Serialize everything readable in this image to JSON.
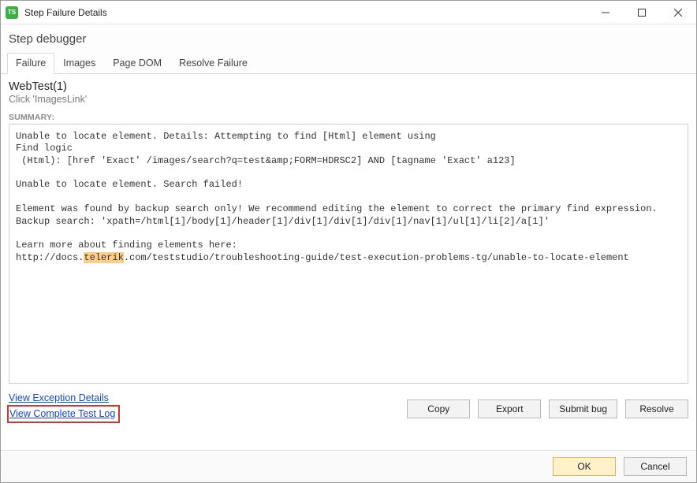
{
  "window": {
    "title": "Step Failure Details",
    "appIconText": "TS"
  },
  "heading": "Step debugger",
  "tabs": [
    {
      "label": "Failure",
      "active": true
    },
    {
      "label": "Images",
      "active": false
    },
    {
      "label": "Page DOM",
      "active": false
    },
    {
      "label": "Resolve Failure",
      "active": false
    }
  ],
  "test": {
    "name": "WebTest(1)",
    "step": "Click 'ImagesLink'"
  },
  "summaryLabel": "SUMMARY:",
  "summary": {
    "line1": "Unable to locate element. Details: Attempting to find [Html] element using",
    "line2": "Find logic",
    "line3": " (Html): [href 'Exact' /images/search?q=test&amp;FORM=HDRSC2] AND [tagname 'Exact' a123]",
    "line4": "Unable to locate element. Search failed!",
    "line5": "Element was found by backup search only! We recommend editing the element to correct the primary find expression.",
    "line6": "Backup search: 'xpath=/html[1]/body[1]/header[1]/div[1]/div[1]/div[1]/nav[1]/ul[1]/li[2]/a[1]'",
    "line7": "Learn more about finding elements here:",
    "url_pre": "http://docs.",
    "url_hl": "telerik",
    "url_post": ".com/teststudio/troubleshooting-guide/test-execution-problems-tg/unable-to-locate-element"
  },
  "links": {
    "exception": "View Exception Details",
    "completeLog": "View Complete Test Log"
  },
  "buttons": {
    "copy": "Copy",
    "export": "Export",
    "submitBug": "Submit bug",
    "resolve": "Resolve",
    "ok": "OK",
    "cancel": "Cancel"
  }
}
